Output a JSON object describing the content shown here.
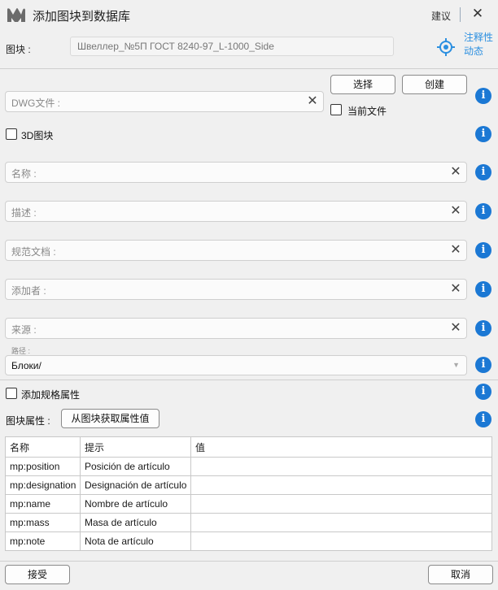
{
  "window": {
    "title": "添加图块到数据库",
    "suggest": "建议",
    "close": "✕"
  },
  "block": {
    "label": "图块 :",
    "value": "Швеллер_№5П ГОСТ 8240-97_L-1000_Side"
  },
  "annotation": {
    "line1": "注释性",
    "line2": "动态"
  },
  "buttons": {
    "select": "选择",
    "create": "创建",
    "get_attrs": "从图块获取属性值",
    "accept": "接受",
    "cancel": "取消"
  },
  "dwg": {
    "placeholder": "DWG文件 :",
    "current_file_label": "当前文件"
  },
  "block3d": {
    "label": "3D图块"
  },
  "fields": {
    "name": "名称 :",
    "description": "描述 :",
    "normative_doc": "规范文档 :",
    "added_by": "添加者 :",
    "source": "来源 :"
  },
  "path": {
    "label": "路径 :",
    "value": "Блоки/"
  },
  "spec": {
    "add_label": "添加规格属性"
  },
  "attributes": {
    "label": "图块属性 :",
    "columns": [
      "名称",
      "提示",
      "值"
    ],
    "rows": [
      [
        "mp:position",
        "Posición de artículo",
        ""
      ],
      [
        "mp:designation",
        "Designación de artículo",
        ""
      ],
      [
        "mp:name",
        "Nombre de artículo",
        ""
      ],
      [
        "mp:mass",
        "Masa de artículo",
        ""
      ],
      [
        "mp:note",
        "Nota de artículo",
        ""
      ]
    ]
  },
  "icons": {
    "info": "i",
    "clear": "✕",
    "dropdown": "▼"
  },
  "colors": {
    "accent": "#1b78d4",
    "link": "#2b8fe0",
    "logo": "#6b6b6b"
  }
}
